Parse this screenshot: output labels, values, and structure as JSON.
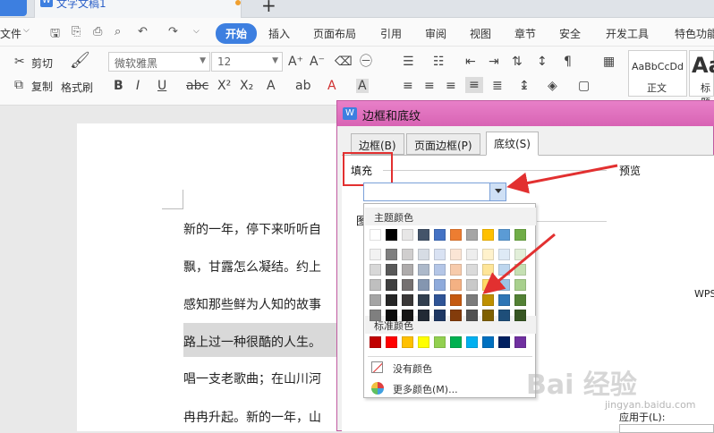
{
  "tabbar": {
    "doc_tab_label": "文字文稿1",
    "new_tab_label": "+"
  },
  "menu": {
    "file_label": "文件",
    "items": [
      "开始",
      "插入",
      "页面布局",
      "引用",
      "审阅",
      "视图",
      "章节",
      "安全",
      "开发工具",
      "特色功能"
    ]
  },
  "toolbar": {
    "cut": "剪切",
    "copy": "复制",
    "format_painter": "格式刷",
    "font_name": "微软雅黑",
    "font_size": "12",
    "style_sample": "AaBbCcDd",
    "style_name": "正文",
    "style2_sample": "Aa",
    "style2_name": "标题"
  },
  "document": {
    "lines": [
      "新的一年，停下来听听自",
      "飘，甘露怎么凝结。约上",
      "感知那些鲜为人知的故事",
      "路上过一种很酷的人生。",
      "唱一支老歌曲；在山川河",
      "冉冉升起。新的一年，山"
    ]
  },
  "dialog": {
    "title": "边框和底纹",
    "tabs": [
      "边框(B)",
      "页面边框(P)",
      "底纹(S)"
    ],
    "fill_label": "填充",
    "preview_label": "预览",
    "pattern_label": "图",
    "preview_text": "WPS",
    "apply_label": "应用于(L):"
  },
  "palette": {
    "theme_header": "主题颜色",
    "standard_header": "标准颜色",
    "no_color": "没有颜色",
    "more_colors": "更多颜色(M)...",
    "theme_base": [
      "#ffffff",
      "#000000",
      "#e7e6e6",
      "#44546a",
      "#4472c4",
      "#ed7d31",
      "#a5a5a5",
      "#ffc000",
      "#5b9bd5",
      "#70ad47"
    ],
    "theme_shades": [
      [
        "#f2f2f2",
        "#7f7f7f",
        "#d0cece",
        "#d6dce4",
        "#d9e2f3",
        "#fbe5d5",
        "#ededed",
        "#fff2cc",
        "#deeaf6",
        "#e2efd9"
      ],
      [
        "#d8d8d8",
        "#595959",
        "#aeabab",
        "#adb9ca",
        "#b4c6e7",
        "#f7cbac",
        "#dbdbdb",
        "#fee599",
        "#bdd6ee",
        "#c5e0b3"
      ],
      [
        "#bfbfbf",
        "#3f3f3f",
        "#757070",
        "#8496b0",
        "#8eaadb",
        "#f4b183",
        "#c9c9c9",
        "#ffd965",
        "#9cc3e5",
        "#a8d08d"
      ],
      [
        "#a5a5a5",
        "#262626",
        "#3a3838",
        "#323f4f",
        "#2f5496",
        "#c55a11",
        "#7b7b7b",
        "#bf9000",
        "#2e75b5",
        "#538135"
      ],
      [
        "#7f7f7f",
        "#0c0c0c",
        "#171616",
        "#222a35",
        "#1f3864",
        "#833c0b",
        "#525252",
        "#7f6000",
        "#1e4e79",
        "#375623"
      ]
    ],
    "standard": [
      "#c00000",
      "#ff0000",
      "#ffc000",
      "#ffff00",
      "#92d050",
      "#00b050",
      "#00b0f0",
      "#0070c0",
      "#002060",
      "#7030a0"
    ]
  },
  "watermark": {
    "text": "Bai 经验",
    "url": "jingyan.baidu.com"
  },
  "colors": {
    "accent": "#3d7fe0",
    "dialog_title": "#e070c0",
    "highlight_box": "#e23030",
    "arrow": "#e23030"
  }
}
